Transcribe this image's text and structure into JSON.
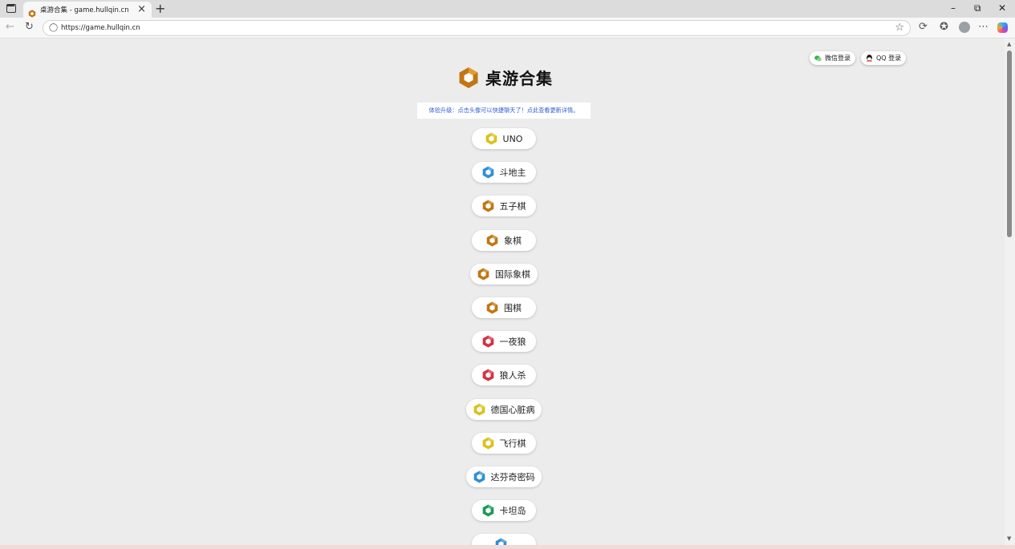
{
  "browser": {
    "tab_title": "桌游合集 - game.hullqin.cn",
    "url": "https://game.hullqin.cn",
    "new_tab_glyph": "+",
    "close_glyph": "×"
  },
  "page": {
    "title": "桌游合集",
    "notice": "体验升级：点击头像可以快捷聊天了！点此查看更新详情。",
    "login": {
      "wechat_label": "微信登录",
      "qq_label": "QQ 登录"
    },
    "games": [
      {
        "label": "UNO",
        "color": "#d9c21a"
      },
      {
        "label": "斗地主",
        "color": "#2e8fd6"
      },
      {
        "label": "五子棋",
        "color": "#c27612"
      },
      {
        "label": "象棋",
        "color": "#c27612"
      },
      {
        "label": "国际象棋",
        "color": "#c27612"
      },
      {
        "label": "围棋",
        "color": "#c27612"
      },
      {
        "label": "一夜狼",
        "color": "#d63040"
      },
      {
        "label": "狼人杀",
        "color": "#d63040"
      },
      {
        "label": "德国心脏病",
        "color": "#d9c21a"
      },
      {
        "label": "飞行棋",
        "color": "#d9c21a"
      },
      {
        "label": "达芬奇密码",
        "color": "#2e8fd6"
      },
      {
        "label": "卡坦岛",
        "color": "#1a9a55"
      },
      {
        "label": "",
        "color": "#2e8fd6"
      }
    ]
  },
  "colors": {
    "brand_hex": "#c27612",
    "notice_text": "#2f5fd6",
    "page_bg": "#ececec"
  },
  "icons": [
    "sidebar-icon",
    "tab-favicon",
    "back-icon",
    "refresh-icon",
    "lock-icon",
    "star-icon",
    "extensions-icon",
    "favorites-icon",
    "profile-icon",
    "more-icon",
    "copilot-icon",
    "wechat-icon",
    "qq-icon",
    "hexagon-logo-icon"
  ]
}
